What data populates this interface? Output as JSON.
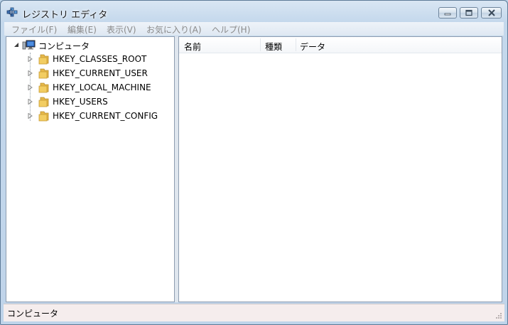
{
  "window": {
    "title": "レジストリ エディタ",
    "icon": "registry-editor-icon"
  },
  "menu": [
    {
      "label": "ファイル(F)"
    },
    {
      "label": "編集(E)"
    },
    {
      "label": "表示(V)"
    },
    {
      "label": "お気に入り(A)"
    },
    {
      "label": "ヘルプ(H)"
    }
  ],
  "tree": {
    "root": {
      "label": "コンピュータ",
      "icon": "computer-icon",
      "expanded": true
    },
    "items": [
      {
        "label": "HKEY_CLASSES_ROOT",
        "icon": "folder-icon"
      },
      {
        "label": "HKEY_CURRENT_USER",
        "icon": "folder-icon"
      },
      {
        "label": "HKEY_LOCAL_MACHINE",
        "icon": "folder-icon"
      },
      {
        "label": "HKEY_USERS",
        "icon": "folder-icon"
      },
      {
        "label": "HKEY_CURRENT_CONFIG",
        "icon": "folder-icon"
      }
    ]
  },
  "list": {
    "columns": [
      {
        "label": "名前"
      },
      {
        "label": "種類"
      },
      {
        "label": "データ"
      }
    ],
    "rows": []
  },
  "status": {
    "text": "コンピュータ"
  },
  "colors": {
    "folder": "#f2cd62",
    "frame": "#bcd3e8",
    "status_bg": "#f5eded"
  }
}
